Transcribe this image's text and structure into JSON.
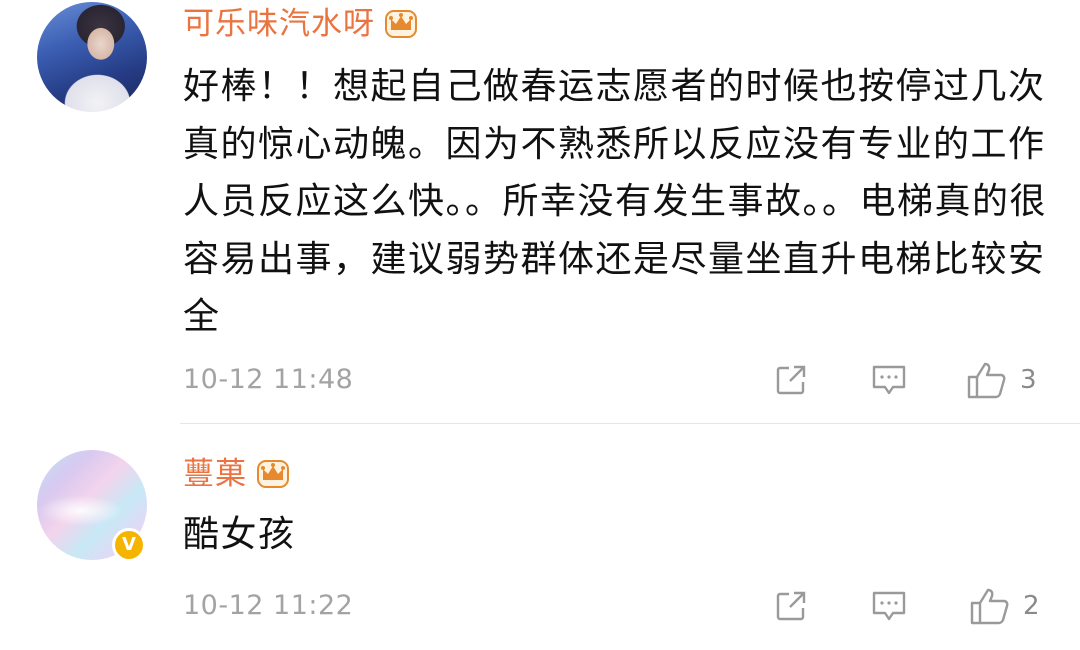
{
  "comments": [
    {
      "username": "可乐味汽水呀",
      "badge_icon": "vip-crown-icon",
      "avatar": "user-photo-avatar",
      "verified": false,
      "text": "好棒！！想起自己做春运志愿者的时候也按停过几次真的惊心动魄。因为不熟悉所以反应没有专业的工作人员反应这么快。。所幸没有发生事故。。电梯真的很容易出事，建议弱势群体还是尽量坐直升电梯比较安全",
      "timestamp": "10-12 11:48",
      "actions": {
        "share_icon": "share-icon",
        "reply_icon": "comment-icon",
        "like_icon": "thumbs-up-icon",
        "like_count": "3"
      }
    },
    {
      "username": "蘴菓",
      "badge_icon": "vip-crown-icon",
      "avatar": "holographic-avatar",
      "verified": true,
      "verified_mark": "V",
      "text": "酷女孩",
      "timestamp": "10-12 11:22",
      "actions": {
        "share_icon": "share-icon",
        "reply_icon": "comment-icon",
        "like_icon": "thumbs-up-icon",
        "like_count": "2"
      }
    }
  ],
  "colors": {
    "username": "#eb7340",
    "text": "#111111",
    "meta": "#a3a3a3",
    "icon": "#9a9a9a",
    "crown": "#e58a2e",
    "verified": "#f5b400"
  }
}
